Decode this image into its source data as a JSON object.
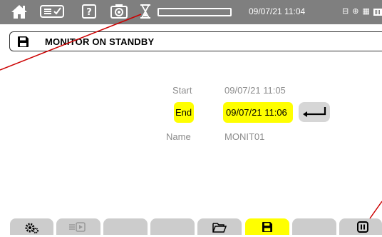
{
  "status_bar": {
    "datetime": "09/07/21 11:04",
    "icons": [
      "home-icon",
      "display-settings-icon",
      "help-icon",
      "camera-icon",
      "hourglass-icon",
      "connectivity-icon",
      "battery-icon"
    ]
  },
  "title_bar": {
    "title": "MONITOR ON STANDBY",
    "icon": "floppy-disk-icon"
  },
  "form": {
    "start_label": "Start",
    "start_value": "09/07/21 11:05",
    "end_label": "End",
    "end_value": "09/07/21 11:06",
    "name_label": "Name",
    "name_value": "MONIT01",
    "enter_icon": "enter-icon"
  },
  "bottom_buttons": [
    {
      "icon": "settings-icon",
      "active": false
    },
    {
      "icon": "export-icon",
      "active": false
    },
    {
      "icon": "",
      "active": false
    },
    {
      "icon": "",
      "active": false
    },
    {
      "icon": "open-folder-icon",
      "active": false
    },
    {
      "icon": "floppy-disk-icon",
      "active": true
    },
    {
      "icon": "",
      "active": false
    },
    {
      "icon": "pause-icon",
      "active": false
    }
  ],
  "colors": {
    "status_bar_bg": "#7f7f7f",
    "highlight": "#ffff00",
    "button_bg": "#cccccc",
    "annotation": "#cc0000",
    "text_muted": "#8c8c8c"
  }
}
